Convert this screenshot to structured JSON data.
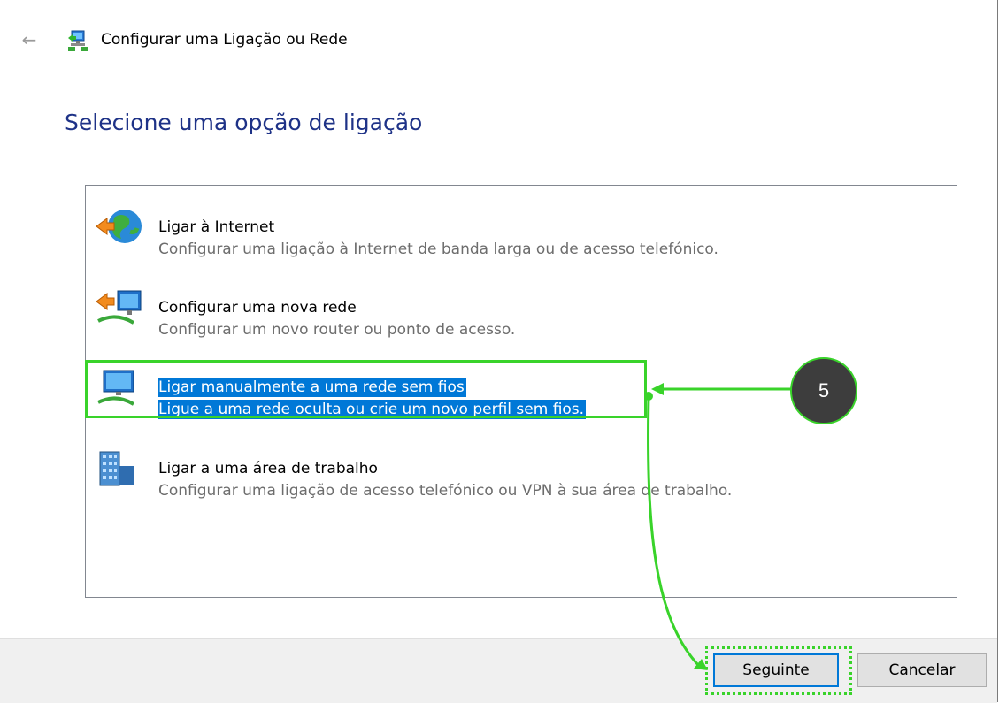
{
  "window": {
    "title": "Configurar uma Ligação ou Rede",
    "back_icon": "back-arrow-icon",
    "app_icon": "network-setup-icon"
  },
  "heading": "Selecione uma opção de ligação",
  "options": [
    {
      "title": "Ligar à Internet",
      "desc": "Configurar uma ligação à Internet de banda larga ou de acesso telefónico.",
      "icon": "internet-globe-icon",
      "selected": false
    },
    {
      "title": "Configurar uma nova rede",
      "desc": "Configurar um novo router ou ponto de acesso.",
      "icon": "new-network-icon",
      "selected": false
    },
    {
      "title": "Ligar manualmente a uma rede sem fios",
      "desc": "Ligue a uma rede oculta ou crie um novo perfil sem fios.",
      "icon": "wireless-network-icon",
      "selected": true
    },
    {
      "title": "Ligar a uma área de trabalho",
      "desc": "Configurar uma ligação de acesso telefónico ou VPN à sua área de trabalho.",
      "icon": "workplace-building-icon",
      "selected": false
    }
  ],
  "callout": {
    "label": "5"
  },
  "buttons": {
    "next": "Seguinte",
    "cancel": "Cancelar"
  },
  "colors": {
    "accent": "#0078d7",
    "highlight": "#39d32a",
    "heading": "#1e3287"
  }
}
